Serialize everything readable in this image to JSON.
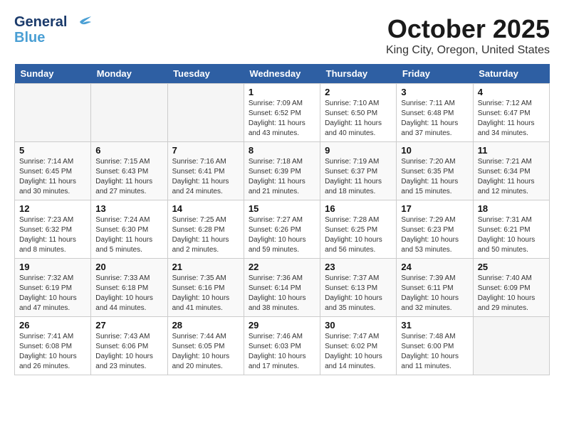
{
  "header": {
    "logo_line1": "General",
    "logo_line2": "Blue",
    "month": "October 2025",
    "location": "King City, Oregon, United States"
  },
  "days_of_week": [
    "Sunday",
    "Monday",
    "Tuesday",
    "Wednesday",
    "Thursday",
    "Friday",
    "Saturday"
  ],
  "weeks": [
    [
      {
        "day": "",
        "info": ""
      },
      {
        "day": "",
        "info": ""
      },
      {
        "day": "",
        "info": ""
      },
      {
        "day": "1",
        "info": "Sunrise: 7:09 AM\nSunset: 6:52 PM\nDaylight: 11 hours\nand 43 minutes."
      },
      {
        "day": "2",
        "info": "Sunrise: 7:10 AM\nSunset: 6:50 PM\nDaylight: 11 hours\nand 40 minutes."
      },
      {
        "day": "3",
        "info": "Sunrise: 7:11 AM\nSunset: 6:48 PM\nDaylight: 11 hours\nand 37 minutes."
      },
      {
        "day": "4",
        "info": "Sunrise: 7:12 AM\nSunset: 6:47 PM\nDaylight: 11 hours\nand 34 minutes."
      }
    ],
    [
      {
        "day": "5",
        "info": "Sunrise: 7:14 AM\nSunset: 6:45 PM\nDaylight: 11 hours\nand 30 minutes."
      },
      {
        "day": "6",
        "info": "Sunrise: 7:15 AM\nSunset: 6:43 PM\nDaylight: 11 hours\nand 27 minutes."
      },
      {
        "day": "7",
        "info": "Sunrise: 7:16 AM\nSunset: 6:41 PM\nDaylight: 11 hours\nand 24 minutes."
      },
      {
        "day": "8",
        "info": "Sunrise: 7:18 AM\nSunset: 6:39 PM\nDaylight: 11 hours\nand 21 minutes."
      },
      {
        "day": "9",
        "info": "Sunrise: 7:19 AM\nSunset: 6:37 PM\nDaylight: 11 hours\nand 18 minutes."
      },
      {
        "day": "10",
        "info": "Sunrise: 7:20 AM\nSunset: 6:35 PM\nDaylight: 11 hours\nand 15 minutes."
      },
      {
        "day": "11",
        "info": "Sunrise: 7:21 AM\nSunset: 6:34 PM\nDaylight: 11 hours\nand 12 minutes."
      }
    ],
    [
      {
        "day": "12",
        "info": "Sunrise: 7:23 AM\nSunset: 6:32 PM\nDaylight: 11 hours\nand 8 minutes."
      },
      {
        "day": "13",
        "info": "Sunrise: 7:24 AM\nSunset: 6:30 PM\nDaylight: 11 hours\nand 5 minutes."
      },
      {
        "day": "14",
        "info": "Sunrise: 7:25 AM\nSunset: 6:28 PM\nDaylight: 11 hours\nand 2 minutes."
      },
      {
        "day": "15",
        "info": "Sunrise: 7:27 AM\nSunset: 6:26 PM\nDaylight: 10 hours\nand 59 minutes."
      },
      {
        "day": "16",
        "info": "Sunrise: 7:28 AM\nSunset: 6:25 PM\nDaylight: 10 hours\nand 56 minutes."
      },
      {
        "day": "17",
        "info": "Sunrise: 7:29 AM\nSunset: 6:23 PM\nDaylight: 10 hours\nand 53 minutes."
      },
      {
        "day": "18",
        "info": "Sunrise: 7:31 AM\nSunset: 6:21 PM\nDaylight: 10 hours\nand 50 minutes."
      }
    ],
    [
      {
        "day": "19",
        "info": "Sunrise: 7:32 AM\nSunset: 6:19 PM\nDaylight: 10 hours\nand 47 minutes."
      },
      {
        "day": "20",
        "info": "Sunrise: 7:33 AM\nSunset: 6:18 PM\nDaylight: 10 hours\nand 44 minutes."
      },
      {
        "day": "21",
        "info": "Sunrise: 7:35 AM\nSunset: 6:16 PM\nDaylight: 10 hours\nand 41 minutes."
      },
      {
        "day": "22",
        "info": "Sunrise: 7:36 AM\nSunset: 6:14 PM\nDaylight: 10 hours\nand 38 minutes."
      },
      {
        "day": "23",
        "info": "Sunrise: 7:37 AM\nSunset: 6:13 PM\nDaylight: 10 hours\nand 35 minutes."
      },
      {
        "day": "24",
        "info": "Sunrise: 7:39 AM\nSunset: 6:11 PM\nDaylight: 10 hours\nand 32 minutes."
      },
      {
        "day": "25",
        "info": "Sunrise: 7:40 AM\nSunset: 6:09 PM\nDaylight: 10 hours\nand 29 minutes."
      }
    ],
    [
      {
        "day": "26",
        "info": "Sunrise: 7:41 AM\nSunset: 6:08 PM\nDaylight: 10 hours\nand 26 minutes."
      },
      {
        "day": "27",
        "info": "Sunrise: 7:43 AM\nSunset: 6:06 PM\nDaylight: 10 hours\nand 23 minutes."
      },
      {
        "day": "28",
        "info": "Sunrise: 7:44 AM\nSunset: 6:05 PM\nDaylight: 10 hours\nand 20 minutes."
      },
      {
        "day": "29",
        "info": "Sunrise: 7:46 AM\nSunset: 6:03 PM\nDaylight: 10 hours\nand 17 minutes."
      },
      {
        "day": "30",
        "info": "Sunrise: 7:47 AM\nSunset: 6:02 PM\nDaylight: 10 hours\nand 14 minutes."
      },
      {
        "day": "31",
        "info": "Sunrise: 7:48 AM\nSunset: 6:00 PM\nDaylight: 10 hours\nand 11 minutes."
      },
      {
        "day": "",
        "info": ""
      }
    ]
  ]
}
